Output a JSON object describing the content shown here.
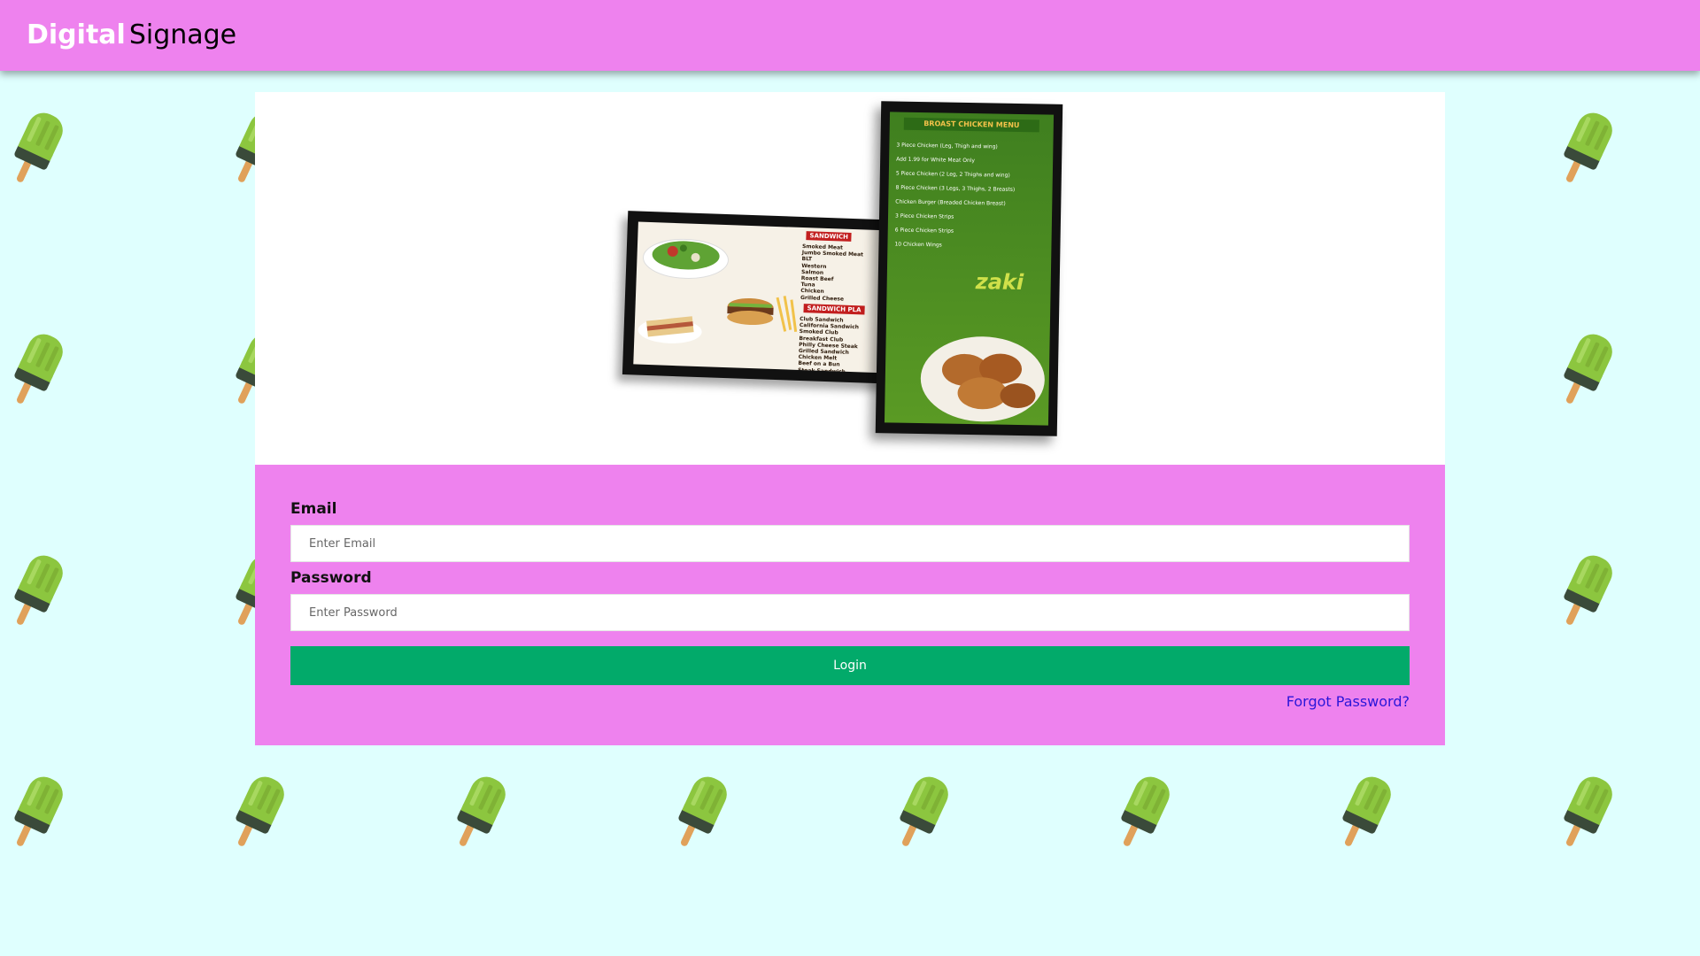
{
  "header": {
    "brand_bold": "Digital",
    "brand_light": "Signage"
  },
  "hero": {
    "illustration_alt": "digital-signage-menu-screens",
    "screen_a": {
      "sandwich_header": "SANDWICH",
      "items_1": "Smoked Meat\nJumbo Smoked Meat\nBLT\nWestern\nSalmon\nRoast Beef\nTuna\nChicken\nGrilled Cheese",
      "platter_header": "SANDWICH PLA",
      "items_2": "Club Sandwich\nCalifornia Sandwich\nSmoked Club\nBreakfast Club\nPhilly Cheese Steak\nGrilled Sandwich\nChicken Melt\nBeef on a Bun\nSteak Sandwich"
    },
    "screen_b": {
      "title": "BROAST CHICKEN MENU",
      "lines": "3 Piece Chicken (Leg, Thigh and wing)\nAdd 1.99 for White Meat Only\n5 Piece Chicken (2 Leg, 2 Thighs and wing)\n8 Piece Chicken (3 Legs, 3 Thighs, 2 Breasts)\nChicken Burger (Breaded Chicken Breast)\n3 Piece Chicken Strips\n6 Piece Chicken Strips\n10 Chicken Wings",
      "logo": "zaki"
    }
  },
  "form": {
    "email_label": "Email",
    "email_placeholder": "Enter Email",
    "email_value": "",
    "password_label": "Password",
    "password_placeholder": "Enter Password",
    "password_value": "",
    "login_label": "Login",
    "forgot_label": "Forgot Password?"
  },
  "colors": {
    "header_bg": "#ee82ee",
    "page_bg": "#dffffe",
    "form_bg": "#ee82ee",
    "login_bg": "#02aa6a",
    "link": "#2a16d9",
    "popsicle": "#8cc63f"
  },
  "icons": {
    "background_pattern": "popsicle-icon"
  }
}
